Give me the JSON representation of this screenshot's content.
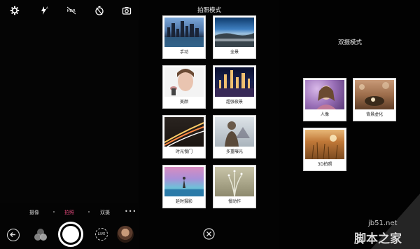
{
  "camera": {
    "top_icons": [
      "gear-icon",
      "flash-auto-icon",
      "hdr-off-icon",
      "timer-off-icon",
      "camera-switch-icon"
    ],
    "modes": [
      {
        "label": "摄像",
        "active": false
      },
      {
        "label": "拍照",
        "active": true
      },
      {
        "label": "双摄",
        "active": false
      }
    ],
    "more_label": "•••",
    "video_btn_label": "LIVE"
  },
  "photo_panel": {
    "title": "拍照模式",
    "tiles": [
      {
        "label": "手动"
      },
      {
        "label": "全景"
      },
      {
        "label": "美颜"
      },
      {
        "label": "超强夜景"
      },
      {
        "label": "时光慢门"
      },
      {
        "label": "多重曝光"
      },
      {
        "label": "延时摄影"
      },
      {
        "label": "慢动作"
      }
    ]
  },
  "dual_panel": {
    "title": "双摄模式",
    "tiles": [
      {
        "label": "人像"
      },
      {
        "label": "背景虚化"
      },
      {
        "label": "3D拍照"
      }
    ]
  },
  "watermark": {
    "url": "jb51.net",
    "logo": "脚本之家"
  },
  "colors": {
    "active_mode": "#e0487a",
    "background": "#000000",
    "tile_bg": "#ffffff"
  }
}
